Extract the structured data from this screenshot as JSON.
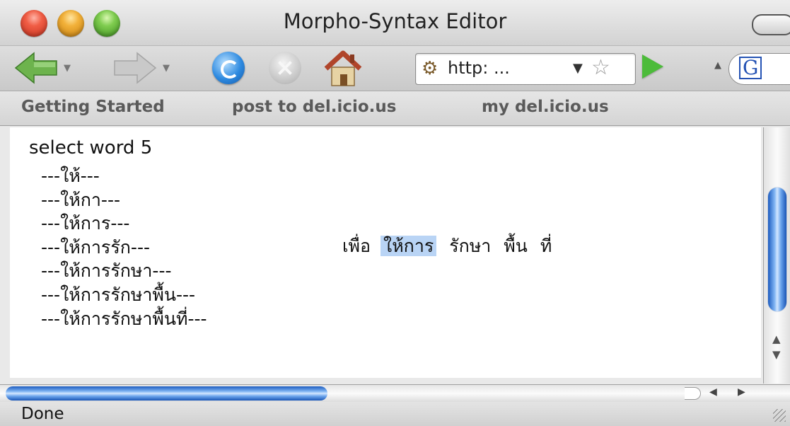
{
  "window": {
    "title": "Morpho-Syntax Editor"
  },
  "toolbar": {
    "url_text": "http: ...",
    "url_dropdown_icon": "▼",
    "search_engine_icon": "G"
  },
  "bookmarks": [
    {
      "label": "Getting Started"
    },
    {
      "label": "post to del.icio.us"
    },
    {
      "label": "my del.icio.us"
    }
  ],
  "content": {
    "heading": "select word 5",
    "words": [
      "---ให้---",
      "---ให้กา---",
      "---ให้การ---",
      "---ให้การรัก---",
      "---ให้การรักษา---",
      "---ให้การรักษาพื้น---",
      "---ให้การรักษาพื้นที่---"
    ],
    "sentence": {
      "tokens": [
        "เพื่อ",
        "ให้การ",
        "รักษา",
        "พื้น",
        "ที่"
      ],
      "selected_index": 1
    }
  },
  "status": {
    "text": "Done"
  },
  "colors": {
    "selection": "#b9d4f5",
    "scroll_thumb": "#3a7be0"
  }
}
